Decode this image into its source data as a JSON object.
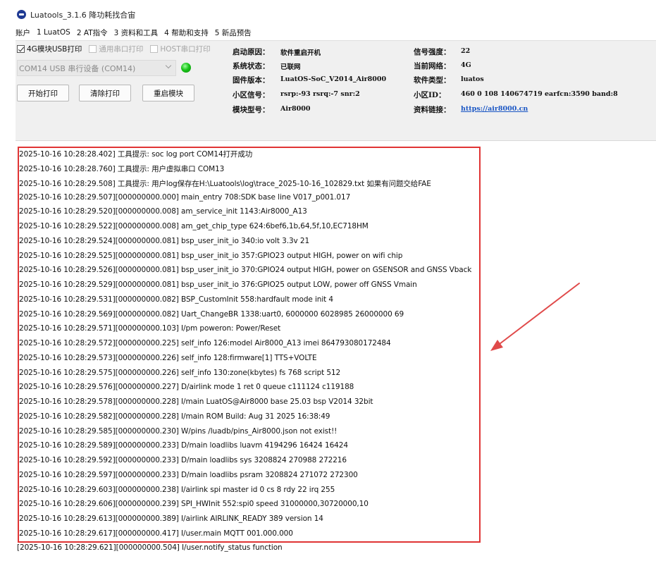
{
  "window": {
    "title": "Luatools_3.1.6 降功耗找合宙"
  },
  "menu": [
    "账户",
    "1 LuatOS",
    "2 AT指令",
    "3 资料和工具",
    "4 帮助和支持",
    "5 新品预告"
  ],
  "options": {
    "usb_print": "4G模块USB打印",
    "serial_print": "通用串口打印",
    "host_print": "HOST串口打印"
  },
  "port": {
    "selected": "COM14 USB 串行设备 (COM14)"
  },
  "buttons": {
    "start": "开始打印",
    "clear": "清除打印",
    "reboot": "重启模块"
  },
  "info": {
    "boot_reason": {
      "label": "启动原因：",
      "value": "软件重启开机"
    },
    "system_status": {
      "label": "系统状态：",
      "value": "已联网"
    },
    "firmware": {
      "label": "固件版本：",
      "value": "LuatOS-SoC_V2014_Air8000"
    },
    "cell_signal": {
      "label": "小区信号：",
      "value": "rsrp:-93 rsrq:-7 snr:2"
    },
    "module_model": {
      "label": "模块型号：",
      "value": "Air8000"
    },
    "signal_strength": {
      "label": "信号强度：",
      "value": "22"
    },
    "current_network": {
      "label": "当前网络：",
      "value": "4G"
    },
    "software_type": {
      "label": "软件类型：",
      "value": "luatos"
    },
    "cell_id": {
      "label": "小区ID：",
      "value": "460 0 108 140674719 earfcn:3590 band:8"
    },
    "doc_link": {
      "label": "资料链接：",
      "value": "https://air8000.cn"
    }
  },
  "log": [
    "2025-10-16 10:28:28.402] 工具提示: soc log port COM14打开成功",
    "2025-10-16 10:28:28.760] 工具提示: 用户虚拟串口 COM13",
    "2025-10-16 10:28:29.508] 工具提示: 用户log保存在H:\\Luatools\\log\\trace_2025-10-16_102829.txt 如果有问题交给FAE",
    "2025-10-16 10:28:29.507][000000000.000] main_entry 708:SDK base line V017_p001.017",
    "2025-10-16 10:28:29.520][000000000.008] am_service_init 1143:Air8000_A13",
    "2025-10-16 10:28:29.522][000000000.008] am_get_chip_type 624:6bef6,1b,64,5f,10,EC718HM",
    "2025-10-16 10:28:29.524][000000000.081] bsp_user_init_io 340:io volt 3.3v 21",
    "2025-10-16 10:28:29.525][000000000.081] bsp_user_init_io 357:GPIO23 output HIGH, power on wifi chip",
    "2025-10-16 10:28:29.526][000000000.081] bsp_user_init_io 370:GPIO24 output HIGH, power on GSENSOR and GNSS Vback",
    "2025-10-16 10:28:29.529][000000000.081] bsp_user_init_io 376:GPIO25 output LOW, power off GNSS Vmain",
    "2025-10-16 10:28:29.531][000000000.082] BSP_CustomInit 558:hardfault mode init 4",
    "2025-10-16 10:28:29.569][000000000.082] Uart_ChangeBR 1338:uart0, 6000000 6028985 26000000 69",
    "2025-10-16 10:28:29.571][000000000.103] I/pm poweron: Power/Reset",
    "2025-10-16 10:28:29.572][000000000.225] self_info 126:model Air8000_A13 imei 864793080172484",
    "2025-10-16 10:28:29.573][000000000.226] self_info 128:firmware[1] TTS+VOLTE",
    "2025-10-16 10:28:29.575][000000000.226] self_info 130:zone(kbytes) fs 768 script 512",
    "2025-10-16 10:28:29.576][000000000.227] D/airlink mode 1 ret 0 queue c111124 c119188",
    "2025-10-16 10:28:29.578][000000000.228] I/main LuatOS@Air8000 base 25.03 bsp V2014 32bit",
    "2025-10-16 10:28:29.582][000000000.228] I/main ROM Build: Aug 31 2025 16:38:49",
    "2025-10-16 10:28:29.585][000000000.230] W/pins /luadb/pins_Air8000.json not exist!!",
    "2025-10-16 10:28:29.589][000000000.233] D/main loadlibs luavm 4194296 16424 16424",
    "2025-10-16 10:28:29.592][000000000.233] D/main loadlibs sys   3208824 270988 272216",
    "2025-10-16 10:28:29.597][000000000.233] D/main loadlibs psram 3208824 271072 272300",
    "2025-10-16 10:28:29.603][000000000.238] I/airlink spi master id 0 cs 8 rdy 22 irq 255",
    "2025-10-16 10:28:29.606][000000000.239] SPI_HWInit 552:spi0 speed 31000000,30720000,10",
    "2025-10-16 10:28:29.613][000000000.389] I/airlink AIRLINK_READY 389 version 14",
    "2025-10-16 10:28:29.617][000000000.417] I/user.main MQTT 001.000.000",
    "[2025-10-16 10:28:29.621][000000000.504] I/user.notify_status function"
  ],
  "colors": {
    "highlight": "#e03434",
    "led": "#19c419",
    "link": "#1a56c4"
  }
}
